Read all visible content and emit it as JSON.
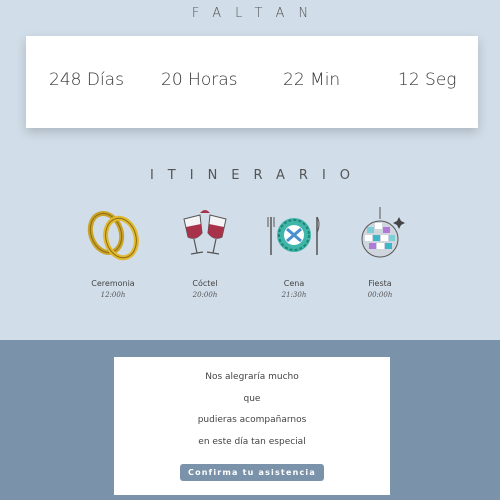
{
  "countdown": {
    "title": "FALTAN",
    "days": "248 Días",
    "hours": "20 Horas",
    "minutes": "22 Min",
    "seconds": "12 Seg"
  },
  "itinerary": {
    "title": "ITINERARIO",
    "events": [
      {
        "label": "Ceremonia",
        "time": "12:00h",
        "icon": "wedding-rings-icon"
      },
      {
        "label": "Cóctel",
        "time": "20:00h",
        "icon": "wine-glasses-icon"
      },
      {
        "label": "Cena",
        "time": "21:30h",
        "icon": "dinner-plate-icon"
      },
      {
        "label": "Fiesta",
        "time": "00:00h",
        "icon": "disco-ball-icon"
      }
    ]
  },
  "message": {
    "lines": [
      "Nos alegraría mucho",
      "que",
      "pudieras acompañarnos",
      "en este día tan especial"
    ],
    "button_label": "Confirma tu asistencia"
  },
  "colors": {
    "top_background": "#d1dde8",
    "bottom_background": "#7b93aa",
    "button": "#7b93aa",
    "card": "#ffffff"
  }
}
